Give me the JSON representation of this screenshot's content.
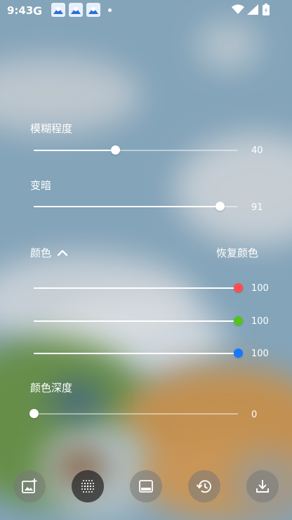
{
  "status_bar": {
    "time": "9:43",
    "g_letter": "G"
  },
  "blur": {
    "label": "模糊程度",
    "value": "40",
    "level": 0.4
  },
  "darken": {
    "label": "变暗",
    "value": "91",
    "level": 0.91
  },
  "color": {
    "label": "颜色",
    "toggle_icon": "chevron-up-icon",
    "reset_label": "恢复颜色",
    "channels": [
      {
        "name": "red",
        "value": "100",
        "level": 1.0,
        "color": "#ff4d4f"
      },
      {
        "name": "green",
        "value": "100",
        "level": 1.0,
        "color": "#52c41a"
      },
      {
        "name": "blue",
        "value": "100",
        "level": 1.0,
        "color": "#1677ff"
      }
    ]
  },
  "color_depth": {
    "label": "颜色深度",
    "value": "0",
    "level": 0.0
  },
  "toolbar": {
    "items": [
      {
        "icon": "add-image-icon"
      },
      {
        "icon": "blur-grid-icon",
        "active": true
      },
      {
        "icon": "layout-panel-icon"
      },
      {
        "icon": "history-icon"
      },
      {
        "icon": "download-icon"
      }
    ]
  }
}
